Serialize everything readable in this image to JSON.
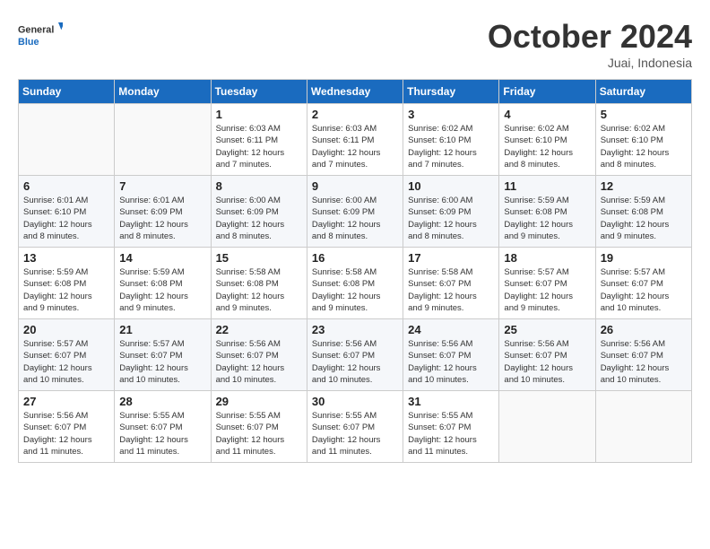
{
  "header": {
    "logo_line1": "General",
    "logo_line2": "Blue",
    "month_title": "October 2024",
    "location": "Juai, Indonesia"
  },
  "days_of_week": [
    "Sunday",
    "Monday",
    "Tuesday",
    "Wednesday",
    "Thursday",
    "Friday",
    "Saturday"
  ],
  "weeks": [
    [
      {
        "day": "",
        "info": ""
      },
      {
        "day": "",
        "info": ""
      },
      {
        "day": "1",
        "info": "Sunrise: 6:03 AM\nSunset: 6:11 PM\nDaylight: 12 hours\nand 7 minutes."
      },
      {
        "day": "2",
        "info": "Sunrise: 6:03 AM\nSunset: 6:11 PM\nDaylight: 12 hours\nand 7 minutes."
      },
      {
        "day": "3",
        "info": "Sunrise: 6:02 AM\nSunset: 6:10 PM\nDaylight: 12 hours\nand 7 minutes."
      },
      {
        "day": "4",
        "info": "Sunrise: 6:02 AM\nSunset: 6:10 PM\nDaylight: 12 hours\nand 8 minutes."
      },
      {
        "day": "5",
        "info": "Sunrise: 6:02 AM\nSunset: 6:10 PM\nDaylight: 12 hours\nand 8 minutes."
      }
    ],
    [
      {
        "day": "6",
        "info": "Sunrise: 6:01 AM\nSunset: 6:10 PM\nDaylight: 12 hours\nand 8 minutes."
      },
      {
        "day": "7",
        "info": "Sunrise: 6:01 AM\nSunset: 6:09 PM\nDaylight: 12 hours\nand 8 minutes."
      },
      {
        "day": "8",
        "info": "Sunrise: 6:00 AM\nSunset: 6:09 PM\nDaylight: 12 hours\nand 8 minutes."
      },
      {
        "day": "9",
        "info": "Sunrise: 6:00 AM\nSunset: 6:09 PM\nDaylight: 12 hours\nand 8 minutes."
      },
      {
        "day": "10",
        "info": "Sunrise: 6:00 AM\nSunset: 6:09 PM\nDaylight: 12 hours\nand 8 minutes."
      },
      {
        "day": "11",
        "info": "Sunrise: 5:59 AM\nSunset: 6:08 PM\nDaylight: 12 hours\nand 9 minutes."
      },
      {
        "day": "12",
        "info": "Sunrise: 5:59 AM\nSunset: 6:08 PM\nDaylight: 12 hours\nand 9 minutes."
      }
    ],
    [
      {
        "day": "13",
        "info": "Sunrise: 5:59 AM\nSunset: 6:08 PM\nDaylight: 12 hours\nand 9 minutes."
      },
      {
        "day": "14",
        "info": "Sunrise: 5:59 AM\nSunset: 6:08 PM\nDaylight: 12 hours\nand 9 minutes."
      },
      {
        "day": "15",
        "info": "Sunrise: 5:58 AM\nSunset: 6:08 PM\nDaylight: 12 hours\nand 9 minutes."
      },
      {
        "day": "16",
        "info": "Sunrise: 5:58 AM\nSunset: 6:08 PM\nDaylight: 12 hours\nand 9 minutes."
      },
      {
        "day": "17",
        "info": "Sunrise: 5:58 AM\nSunset: 6:07 PM\nDaylight: 12 hours\nand 9 minutes."
      },
      {
        "day": "18",
        "info": "Sunrise: 5:57 AM\nSunset: 6:07 PM\nDaylight: 12 hours\nand 9 minutes."
      },
      {
        "day": "19",
        "info": "Sunrise: 5:57 AM\nSunset: 6:07 PM\nDaylight: 12 hours\nand 10 minutes."
      }
    ],
    [
      {
        "day": "20",
        "info": "Sunrise: 5:57 AM\nSunset: 6:07 PM\nDaylight: 12 hours\nand 10 minutes."
      },
      {
        "day": "21",
        "info": "Sunrise: 5:57 AM\nSunset: 6:07 PM\nDaylight: 12 hours\nand 10 minutes."
      },
      {
        "day": "22",
        "info": "Sunrise: 5:56 AM\nSunset: 6:07 PM\nDaylight: 12 hours\nand 10 minutes."
      },
      {
        "day": "23",
        "info": "Sunrise: 5:56 AM\nSunset: 6:07 PM\nDaylight: 12 hours\nand 10 minutes."
      },
      {
        "day": "24",
        "info": "Sunrise: 5:56 AM\nSunset: 6:07 PM\nDaylight: 12 hours\nand 10 minutes."
      },
      {
        "day": "25",
        "info": "Sunrise: 5:56 AM\nSunset: 6:07 PM\nDaylight: 12 hours\nand 10 minutes."
      },
      {
        "day": "26",
        "info": "Sunrise: 5:56 AM\nSunset: 6:07 PM\nDaylight: 12 hours\nand 10 minutes."
      }
    ],
    [
      {
        "day": "27",
        "info": "Sunrise: 5:56 AM\nSunset: 6:07 PM\nDaylight: 12 hours\nand 11 minutes."
      },
      {
        "day": "28",
        "info": "Sunrise: 5:55 AM\nSunset: 6:07 PM\nDaylight: 12 hours\nand 11 minutes."
      },
      {
        "day": "29",
        "info": "Sunrise: 5:55 AM\nSunset: 6:07 PM\nDaylight: 12 hours\nand 11 minutes."
      },
      {
        "day": "30",
        "info": "Sunrise: 5:55 AM\nSunset: 6:07 PM\nDaylight: 12 hours\nand 11 minutes."
      },
      {
        "day": "31",
        "info": "Sunrise: 5:55 AM\nSunset: 6:07 PM\nDaylight: 12 hours\nand 11 minutes."
      },
      {
        "day": "",
        "info": ""
      },
      {
        "day": "",
        "info": ""
      }
    ]
  ]
}
